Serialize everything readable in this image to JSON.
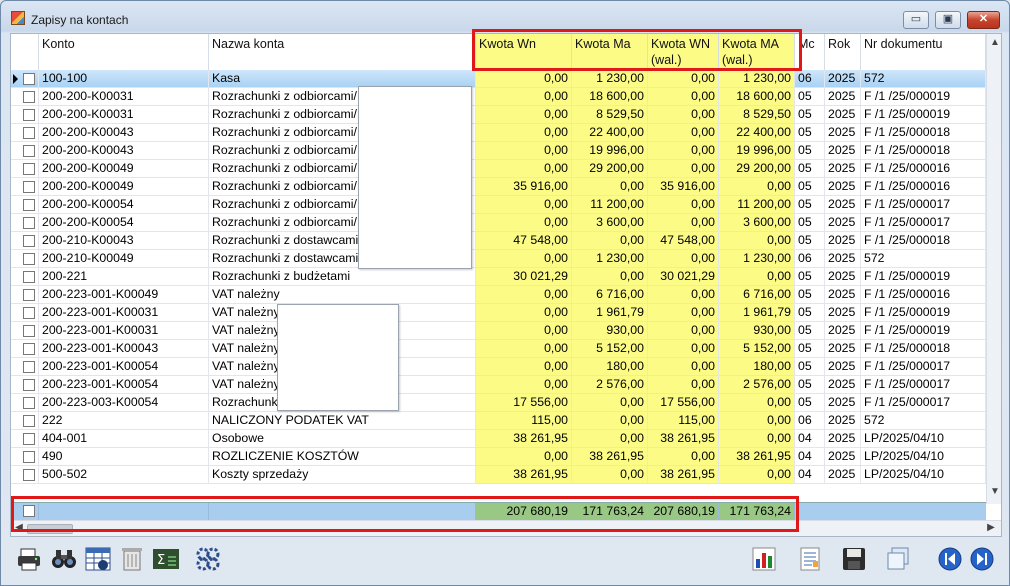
{
  "window": {
    "title": "Zapisy na kontach",
    "min_label": "▭",
    "max_label": "▣",
    "close_label": "✕"
  },
  "columns": {
    "konto": "Konto",
    "nazwa": "Nazwa konta",
    "wn": "Kwota Wn",
    "ma": "Kwota Ma",
    "wn_wal": "Kwota WN (wal.)",
    "ma_wal": "Kwota MA (wal.)",
    "mc": "Mc",
    "rok": "Rok",
    "nr": "Nr dokumentu"
  },
  "rows": [
    {
      "konto": "100-100",
      "nazwa": "Kasa",
      "wn": "0,00",
      "ma": "1 230,00",
      "wnw": "0,00",
      "maw": "1 230,00",
      "mc": "06",
      "rok": "2025",
      "nr": "572"
    },
    {
      "konto": "200-200-K00031",
      "nazwa": "Rozrachunki z odbiorcami/",
      "wn": "0,00",
      "ma": "18 600,00",
      "wnw": "0,00",
      "maw": "18 600,00",
      "mc": "05",
      "rok": "2025",
      "nr": "F /1 /25/000019"
    },
    {
      "konto": "200-200-K00031",
      "nazwa": "Rozrachunki z odbiorcami/",
      "wn": "0,00",
      "ma": "8 529,50",
      "wnw": "0,00",
      "maw": "8 529,50",
      "mc": "05",
      "rok": "2025",
      "nr": "F /1 /25/000019"
    },
    {
      "konto": "200-200-K00043",
      "nazwa": "Rozrachunki z odbiorcami/",
      "wn": "0,00",
      "ma": "22 400,00",
      "wnw": "0,00",
      "maw": "22 400,00",
      "mc": "05",
      "rok": "2025",
      "nr": "F /1 /25/000018"
    },
    {
      "konto": "200-200-K00043",
      "nazwa": "Rozrachunki z odbiorcami/",
      "wn": "0,00",
      "ma": "19 996,00",
      "wnw": "0,00",
      "maw": "19 996,00",
      "mc": "05",
      "rok": "2025",
      "nr": "F /1 /25/000018"
    },
    {
      "konto": "200-200-K00049",
      "nazwa": "Rozrachunki z odbiorcami/",
      "wn": "0,00",
      "ma": "29 200,00",
      "wnw": "0,00",
      "maw": "29 200,00",
      "mc": "05",
      "rok": "2025",
      "nr": "F /1 /25/000016"
    },
    {
      "konto": "200-200-K00049",
      "nazwa": "Rozrachunki z odbiorcami/",
      "wn": "35 916,00",
      "ma": "0,00",
      "wnw": "35 916,00",
      "maw": "0,00",
      "mc": "05",
      "rok": "2025",
      "nr": "F /1 /25/000016"
    },
    {
      "konto": "200-200-K00054",
      "nazwa": "Rozrachunki z odbiorcami/",
      "wn": "0,00",
      "ma": "11 200,00",
      "wnw": "0,00",
      "maw": "11 200,00",
      "mc": "05",
      "rok": "2025",
      "nr": "F /1 /25/000017"
    },
    {
      "konto": "200-200-K00054",
      "nazwa": "Rozrachunki z odbiorcami/",
      "wn": "0,00",
      "ma": "3 600,00",
      "wnw": "0,00",
      "maw": "3 600,00",
      "mc": "05",
      "rok": "2025",
      "nr": "F /1 /25/000017"
    },
    {
      "konto": "200-210-K00043",
      "nazwa": "Rozrachunki z dostawcami",
      "wn": "47 548,00",
      "ma": "0,00",
      "wnw": "47 548,00",
      "maw": "0,00",
      "mc": "05",
      "rok": "2025",
      "nr": "F /1 /25/000018"
    },
    {
      "konto": "200-210-K00049",
      "nazwa": "Rozrachunki z dostawcami",
      "wn": "0,00",
      "ma": "1 230,00",
      "wnw": "0,00",
      "maw": "1 230,00",
      "mc": "06",
      "rok": "2025",
      "nr": "572"
    },
    {
      "konto": "200-221",
      "nazwa": "Rozrachunki z budżetami",
      "wn": "30 021,29",
      "ma": "0,00",
      "wnw": "30 021,29",
      "maw": "0,00",
      "mc": "05",
      "rok": "2025",
      "nr": "F /1 /25/000019"
    },
    {
      "konto": "200-223-001-K00049",
      "nazwa": "VAT należny",
      "wn": "0,00",
      "ma": "6 716,00",
      "wnw": "0,00",
      "maw": "6 716,00",
      "mc": "05",
      "rok": "2025",
      "nr": "F /1 /25/000016"
    },
    {
      "konto": "200-223-001-K00031",
      "nazwa": "VAT należny",
      "wn": "0,00",
      "ma": "1 961,79",
      "wnw": "0,00",
      "maw": "1 961,79",
      "mc": "05",
      "rok": "2025",
      "nr": "F /1 /25/000019"
    },
    {
      "konto": "200-223-001-K00031",
      "nazwa": "VAT należny",
      "wn": "0,00",
      "ma": "930,00",
      "wnw": "0,00",
      "maw": "930,00",
      "mc": "05",
      "rok": "2025",
      "nr": "F /1 /25/000019"
    },
    {
      "konto": "200-223-001-K00043",
      "nazwa": "VAT należny",
      "wn": "0,00",
      "ma": "5 152,00",
      "wnw": "0,00",
      "maw": "5 152,00",
      "mc": "05",
      "rok": "2025",
      "nr": "F /1 /25/000018"
    },
    {
      "konto": "200-223-001-K00054",
      "nazwa": "VAT należny",
      "wn": "0,00",
      "ma": "180,00",
      "wnw": "0,00",
      "maw": "180,00",
      "mc": "05",
      "rok": "2025",
      "nr": "F /1 /25/000017"
    },
    {
      "konto": "200-223-001-K00054",
      "nazwa": "VAT należny",
      "wn": "0,00",
      "ma": "2 576,00",
      "wnw": "0,00",
      "maw": "2 576,00",
      "mc": "05",
      "rok": "2025",
      "nr": "F /1 /25/000017"
    },
    {
      "konto": "200-223-003-K00054",
      "nazwa": "Rozrachunki",
      "wn": "17 556,00",
      "ma": "0,00",
      "wnw": "17 556,00",
      "maw": "0,00",
      "mc": "05",
      "rok": "2025",
      "nr": "F /1 /25/000017"
    },
    {
      "konto": "222",
      "nazwa": "NALICZONY PODATEK VAT",
      "wn": "115,00",
      "ma": "0,00",
      "wnw": "115,00",
      "maw": "0,00",
      "mc": "06",
      "rok": "2025",
      "nr": "572"
    },
    {
      "konto": "404-001",
      "nazwa": "Osobowe",
      "wn": "38 261,95",
      "ma": "0,00",
      "wnw": "38 261,95",
      "maw": "0,00",
      "mc": "04",
      "rok": "2025",
      "nr": "LP/2025/04/10"
    },
    {
      "konto": "490",
      "nazwa": "ROZLICZENIE KOSZTÓW",
      "wn": "0,00",
      "ma": "38 261,95",
      "wnw": "0,00",
      "maw": "38 261,95",
      "mc": "04",
      "rok": "2025",
      "nr": "LP/2025/04/10"
    },
    {
      "konto": "500-502",
      "nazwa": "Koszty sprzedaży",
      "wn": "38 261,95",
      "ma": "0,00",
      "wnw": "38 261,95",
      "maw": "0,00",
      "mc": "04",
      "rok": "2025",
      "nr": "LP/2025/04/10"
    }
  ],
  "totals": {
    "wn": "207 680,19",
    "ma": "171 763,24",
    "wn_wal": "207 680,19",
    "ma_wal": "171 763,24"
  },
  "scroll": {
    "up": "▲",
    "down": "▼",
    "left": "◀",
    "right": "▶",
    "row_pointer": "▶"
  },
  "colors": {
    "highlight": "#fbfb86",
    "totals": "#99c884",
    "annotation": "#e01818",
    "selected_row": "#a8d2f4"
  },
  "toolbar": {
    "icons": [
      "printer-icon",
      "binoculars-icon",
      "calculator-table-icon",
      "delete-icon",
      "sum-icon",
      "gears-icon",
      "chart-icon",
      "report-icon",
      "save-icon",
      "copy-icon",
      "previous-icon",
      "next-icon"
    ]
  }
}
